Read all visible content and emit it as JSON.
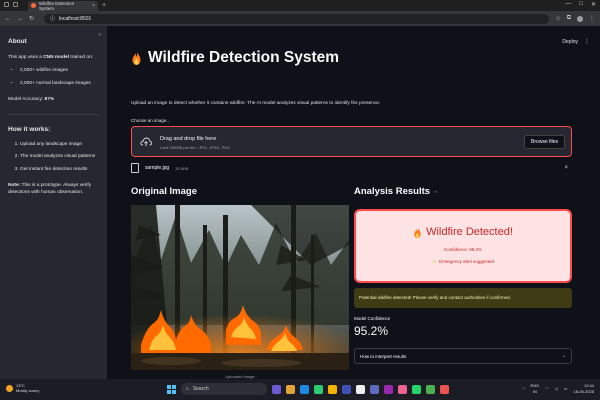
{
  "browser": {
    "tab_title": "Wildfire Detection System",
    "tab_close": "×",
    "new_tab": "+",
    "url": "localhost:8501",
    "window_controls": [
      "—",
      "□",
      "✕"
    ]
  },
  "sidebar": {
    "collapse_icon": "«",
    "about_heading": "About",
    "about_prefix": "This app uses a ",
    "about_bold": "CNN model",
    "about_suffix": " trained on:",
    "dataset_items": [
      "2,000+ wildfire images",
      "2,000+ normal landscape images"
    ],
    "accuracy_label": "Model Accuracy: ",
    "accuracy_value": "87%",
    "how_heading": "How it works:",
    "steps": [
      "Upload any landscape image",
      "The model analyzes visual patterns",
      "Get instant fire detection results"
    ],
    "note_label": "Note:",
    "note_text": " This is a prototype. Always verify detections with human observation."
  },
  "main": {
    "deploy_label": "Deploy",
    "menu_icon": "⋮",
    "title": "Wildfire Detection System",
    "description": "Upload an image to detect whether it contains wildfire. The AI model analyzes visual patterns to identify fire presence.",
    "uploader": {
      "label": "Choose an image...",
      "drag_text": "Drag and drop file here",
      "limit_text": "Limit 200MB per file • JPG, JPEG, PNG",
      "browse_label": "Browse files"
    },
    "file": {
      "name": "sample.jpg",
      "size": "33.6KB",
      "close": "×"
    },
    "left_heading": "Original Image",
    "image_caption": "Uploaded Image",
    "right_heading": "Analysis Results",
    "link_icon": "∞",
    "result": {
      "title": "Wildfire Detected!",
      "confidence_text": "Confidence: 95.2%",
      "alert_text": "Emergency alert suggested"
    },
    "warning_text": "Potential wildfire detected! Please verify and contact authorities if confirmed.",
    "metric_label": "Model Confidence",
    "metric_value": "95.2%",
    "expander_label": "How to interpret results",
    "expander_chevron": "⌄",
    "progress": 1.0
  },
  "taskbar": {
    "weather_temp": "13°C",
    "weather_desc": "Mostly sunny",
    "search_placeholder": "Search",
    "lang_top": "ENG",
    "lang_bottom": "IN",
    "time": "12:44",
    "date": "18-05-2025",
    "app_colors": [
      "#6b5bd2",
      "#e0a43a",
      "#1e88e5",
      "#2ecc71",
      "#f4b400",
      "#3f51b5",
      "#eeeeee",
      "#5c6bc0",
      "#9c27b0",
      "#f06292",
      "#25d366",
      "#4caf50",
      "#ef5350"
    ]
  },
  "colors": {
    "accent": "#ff4b4b",
    "progress_bar": "#ff5722",
    "alert_bg": "#fde3e3",
    "warning_bg": "#3e3b15"
  }
}
